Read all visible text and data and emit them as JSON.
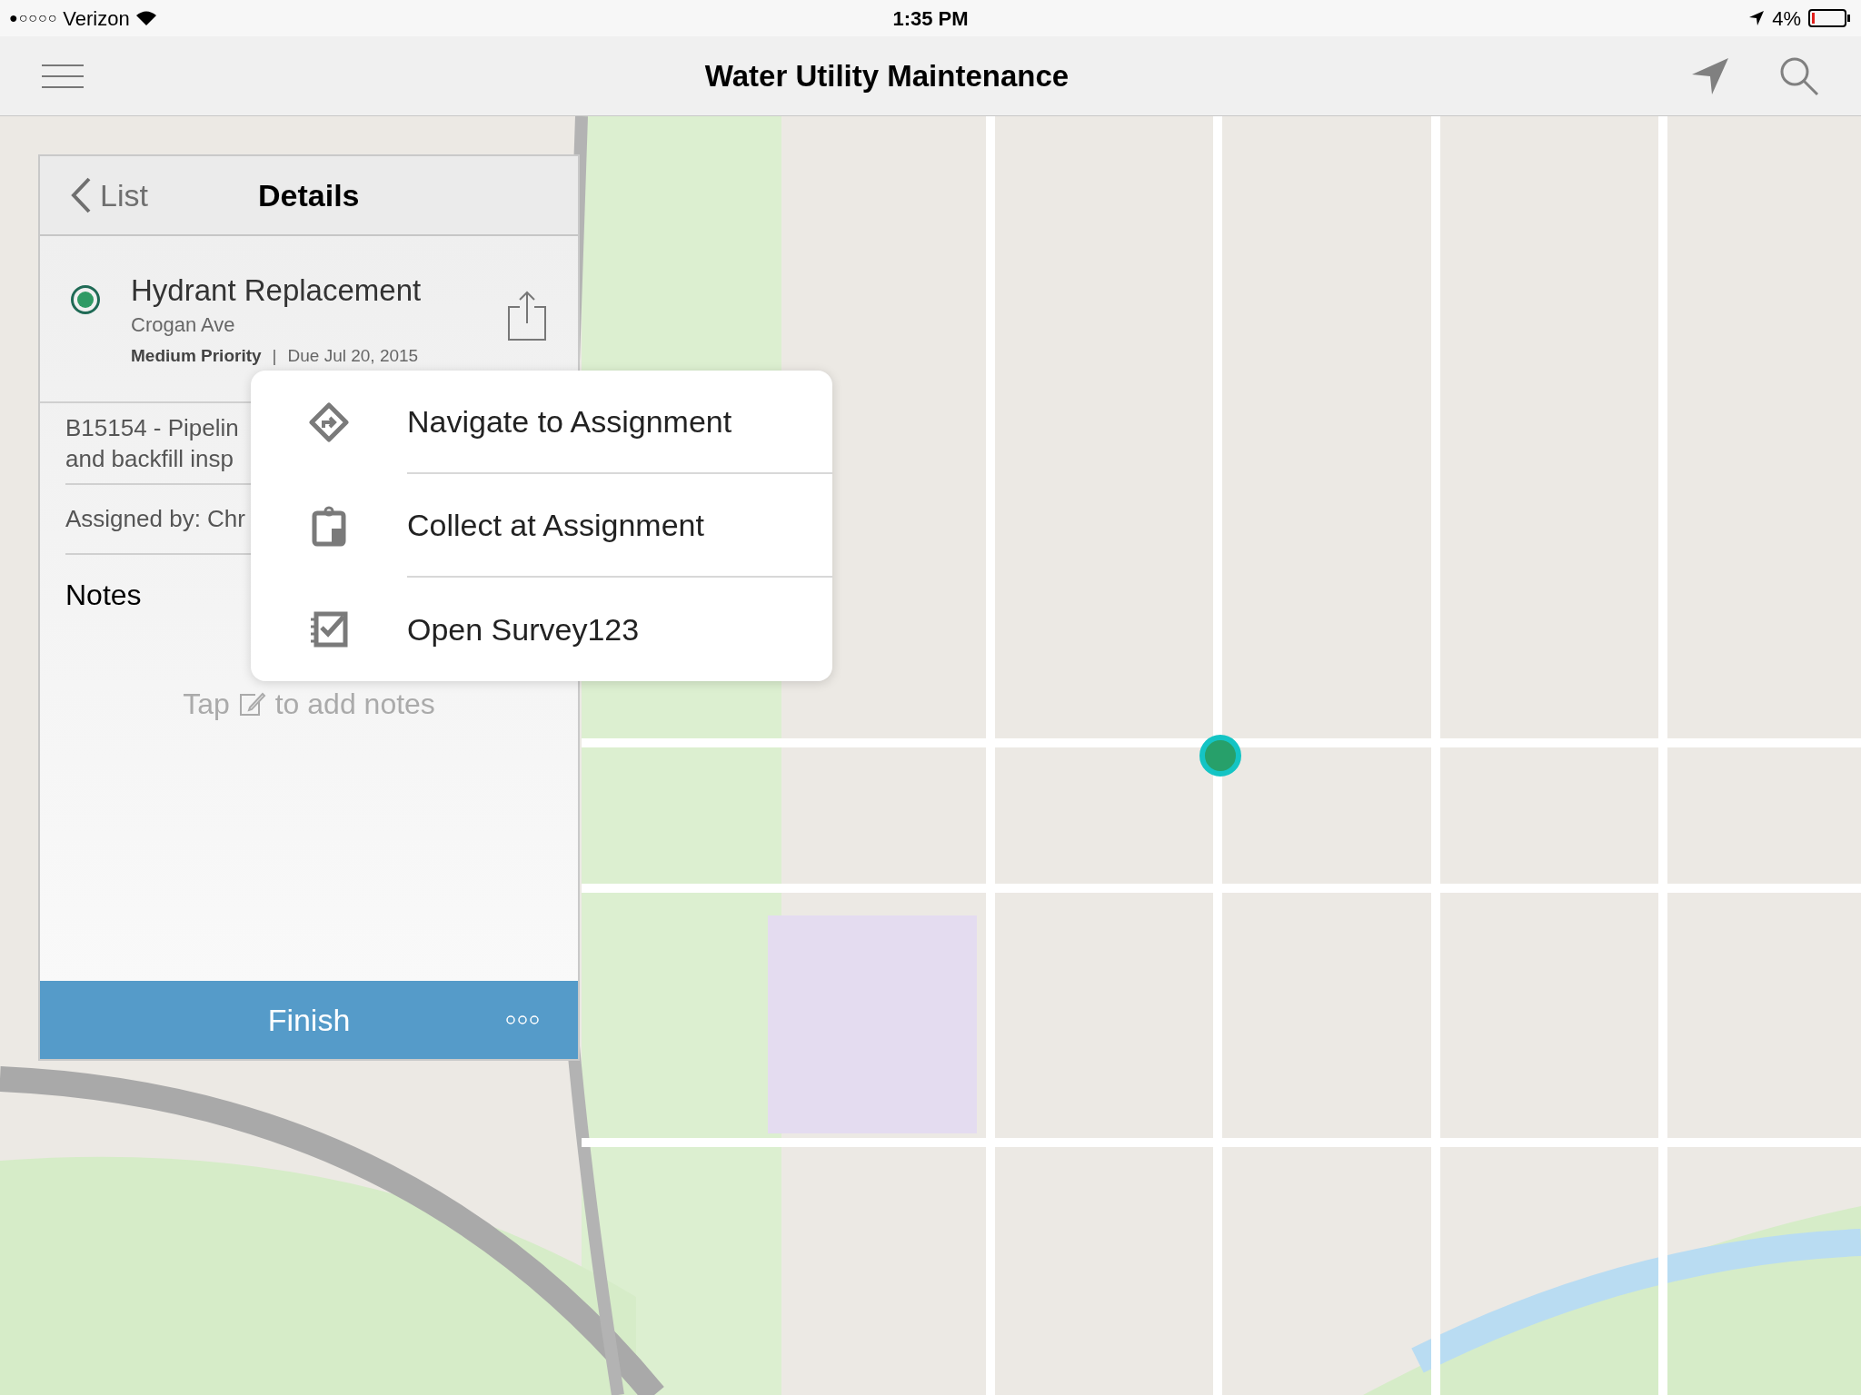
{
  "status_bar": {
    "signal": "●○○○○",
    "carrier": "Verizon",
    "time": "1:35 PM",
    "battery": "4%"
  },
  "header": {
    "title": "Water Utility Maintenance"
  },
  "details": {
    "back": "List",
    "title": "Details",
    "assignment": {
      "selected": true,
      "title": "Hydrant Replacement",
      "location": "Crogan Ave",
      "priority": "Medium Priority",
      "separator": "|",
      "due": "Due Jul 20, 2015"
    },
    "description": [
      "B15154 - Pipelin",
      "and backfill insp"
    ],
    "assigned": "Assigned by: Chr",
    "notes_heading": "Notes",
    "notes_hint": [
      "Tap",
      "to add notes"
    ],
    "finish": "Finish"
  },
  "menu": [
    {
      "kind": "navigate",
      "label": "Navigate to Assignment"
    },
    {
      "kind": "collect",
      "label": "Collect at Assignment"
    },
    {
      "kind": "survey",
      "label": "Open Survey123"
    }
  ]
}
